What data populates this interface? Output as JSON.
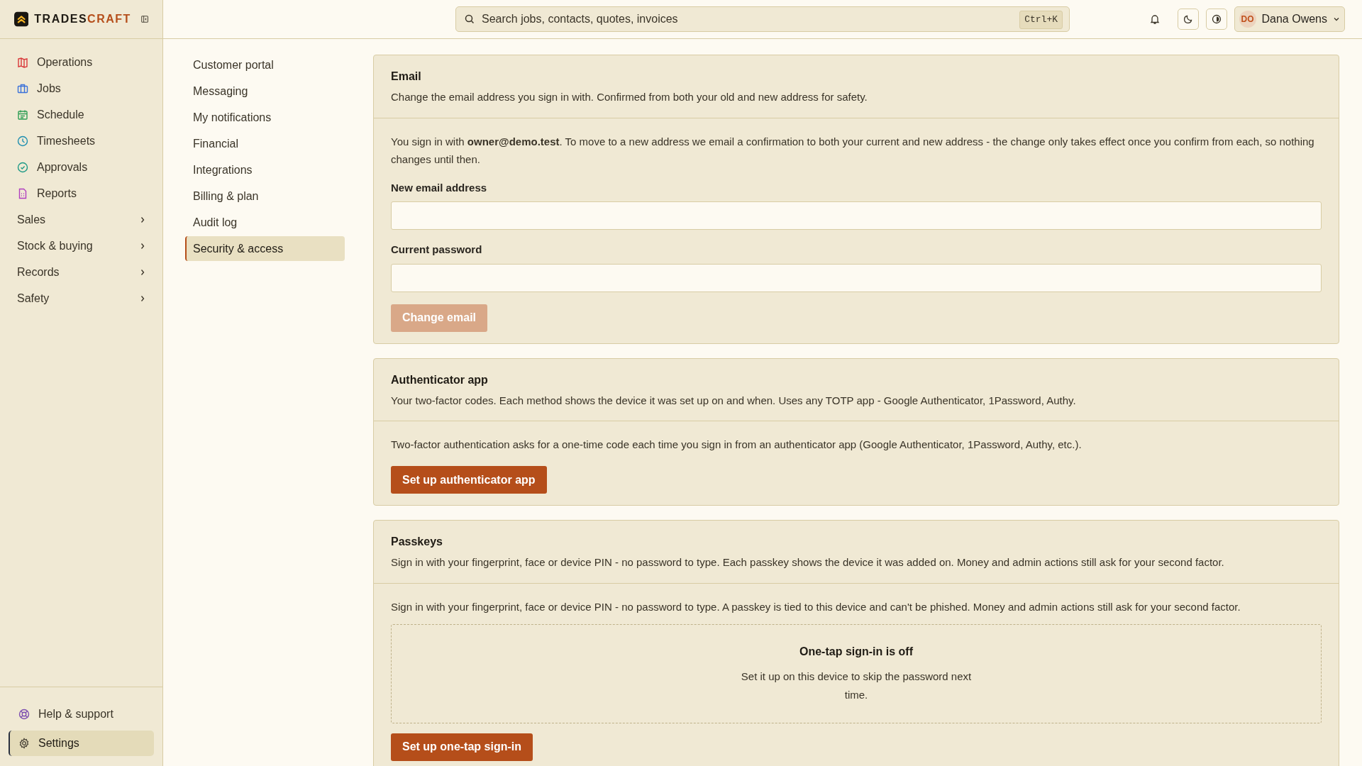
{
  "brand": {
    "name_first": "TRADES",
    "name_second": "CRAFT"
  },
  "nav": [
    {
      "label": "Operations",
      "kind": "link",
      "selected": false
    },
    {
      "label": "Jobs",
      "kind": "link",
      "selected": false
    },
    {
      "label": "Schedule",
      "kind": "link",
      "selected": false
    },
    {
      "label": "Timesheets",
      "kind": "link",
      "selected": false
    },
    {
      "label": "Approvals",
      "kind": "link",
      "selected": false
    },
    {
      "label": "Reports",
      "kind": "link",
      "selected": false
    },
    {
      "label": "Sales",
      "kind": "group",
      "selected": false
    },
    {
      "label": "Stock & buying",
      "kind": "group",
      "selected": false
    },
    {
      "label": "Records",
      "kind": "group",
      "selected": false
    },
    {
      "label": "Safety",
      "kind": "group",
      "selected": false
    }
  ],
  "footer_nav": [
    {
      "label": "Help & support",
      "selected": false
    },
    {
      "label": "Settings",
      "selected": true
    }
  ],
  "settings_nav": [
    {
      "label": "Customer portal",
      "selected": false
    },
    {
      "label": "Messaging",
      "selected": false
    },
    {
      "label": "My notifications",
      "selected": false
    },
    {
      "label": "Financial",
      "selected": false
    },
    {
      "label": "Integrations",
      "selected": false
    },
    {
      "label": "Billing & plan",
      "selected": false
    },
    {
      "label": "Audit log",
      "selected": false
    },
    {
      "label": "Security & access",
      "selected": true
    }
  ],
  "search": {
    "placeholder": "Search jobs, contacts, quotes, invoices",
    "shortcut": "Ctrl+K"
  },
  "user": {
    "initials": "DO",
    "name": "Dana Owens"
  },
  "sections": [
    {
      "kind": "email",
      "title": "Email",
      "description": "Change the email address you sign in with. Confirmed from both your old and new address for safety.",
      "body": "You sign in with **owner@demo.test**. To move to a new address we email a confirmation to both your current and new address - the change only takes effect once you confirm from each, so nothing changes until then.",
      "fields": [
        {
          "label": "New email address"
        },
        {
          "label": "Current password"
        }
      ],
      "button": {
        "label": "Change email",
        "disabled": true
      }
    },
    {
      "kind": "authenticator",
      "title": "Authenticator app",
      "description": "Your two-factor codes. Each method shows the device it was set up on and when. Uses any TOTP app - Google Authenticator, 1Password, Authy.",
      "body": "Two-factor authentication asks for a one-time code each time you sign in from an authenticator app (Google Authenticator, 1Password, Authy, etc.).",
      "button": {
        "label": "Set up authenticator app",
        "disabled": false
      }
    },
    {
      "kind": "passkeys",
      "title": "Passkeys",
      "description": "Sign in with your fingerprint, face or device PIN - no password to type. Each passkey shows the device it was added on. Money and admin actions still ask for your second factor.",
      "body": "Sign in with your fingerprint, face or device PIN - no password to type. A passkey is tied to this device and can't be phished. Money and admin actions still ask for your second factor.",
      "empty": {
        "title": "One-tap sign-in is off",
        "text": "Set it up on this device to skip the password next time."
      },
      "button": {
        "label": "Set up one-tap sign-in",
        "disabled": false
      }
    }
  ]
}
